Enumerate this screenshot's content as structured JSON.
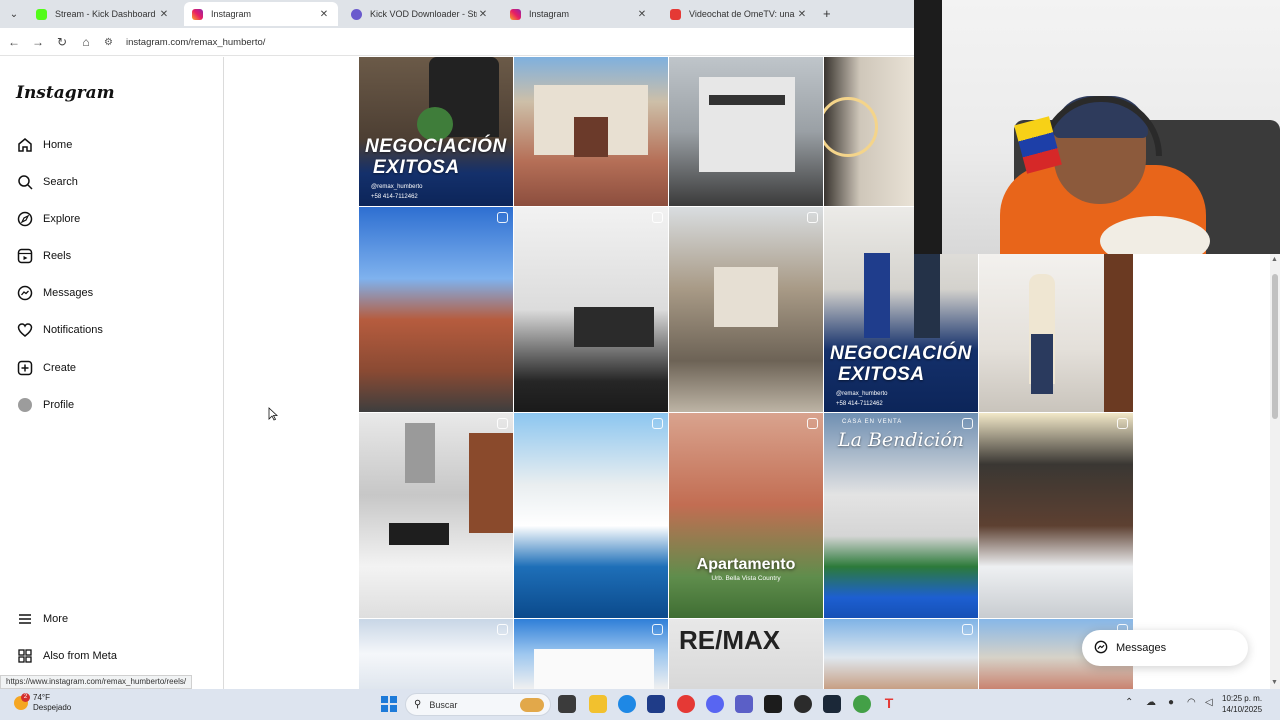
{
  "browser": {
    "tabs": [
      {
        "title": "Stream - Kick Dashboard",
        "active": false
      },
      {
        "title": "Instagram",
        "active": true
      },
      {
        "title": "Kick VOD Downloader - Stream",
        "active": false
      },
      {
        "title": "Instagram",
        "active": false
      },
      {
        "title": "Videochat de OmeTV: una alte",
        "active": false
      }
    ],
    "url": "instagram.com/remax_humberto/",
    "status_url": "https://www.instagram.com/remax_humberto/reels/"
  },
  "sidebar": {
    "logo": "Instagram",
    "items": [
      {
        "label": "Home",
        "icon": "home-icon"
      },
      {
        "label": "Search",
        "icon": "search-icon"
      },
      {
        "label": "Explore",
        "icon": "explore-icon"
      },
      {
        "label": "Reels",
        "icon": "reels-icon"
      },
      {
        "label": "Messages",
        "icon": "messenger-icon"
      },
      {
        "label": "Notifications",
        "icon": "heart-icon"
      },
      {
        "label": "Create",
        "icon": "plus-square-icon"
      },
      {
        "label": "Profile",
        "icon": "avatar"
      }
    ],
    "more": "More",
    "also_from_meta": "Also from Meta"
  },
  "posts": {
    "negociacion_title_line1": "NEGOCIACIÓN",
    "negociacion_title_line2": "EXITOSA",
    "handle": "@remax_humberto",
    "phone": "+58 414-7112462",
    "apartamento": "Apartamento",
    "apartamento_sub": "Urb. Bella Vista Country",
    "bendicion_small": "CASA EN VENTA",
    "bendicion_title": "La Bendición",
    "remax_word": "RE/MAX"
  },
  "messages_pill": {
    "label": "Messages"
  },
  "taskbar": {
    "weather_temp": "74°F",
    "weather_desc": "Despejado",
    "weather_badge": "2",
    "search_placeholder": "Buscar",
    "time": "10:25 p. m.",
    "date": "14/10/2025"
  },
  "colors": {
    "accent": "#1e7bd9",
    "chrome": "#dfe3e8",
    "taskbar": "#dde4ef"
  }
}
